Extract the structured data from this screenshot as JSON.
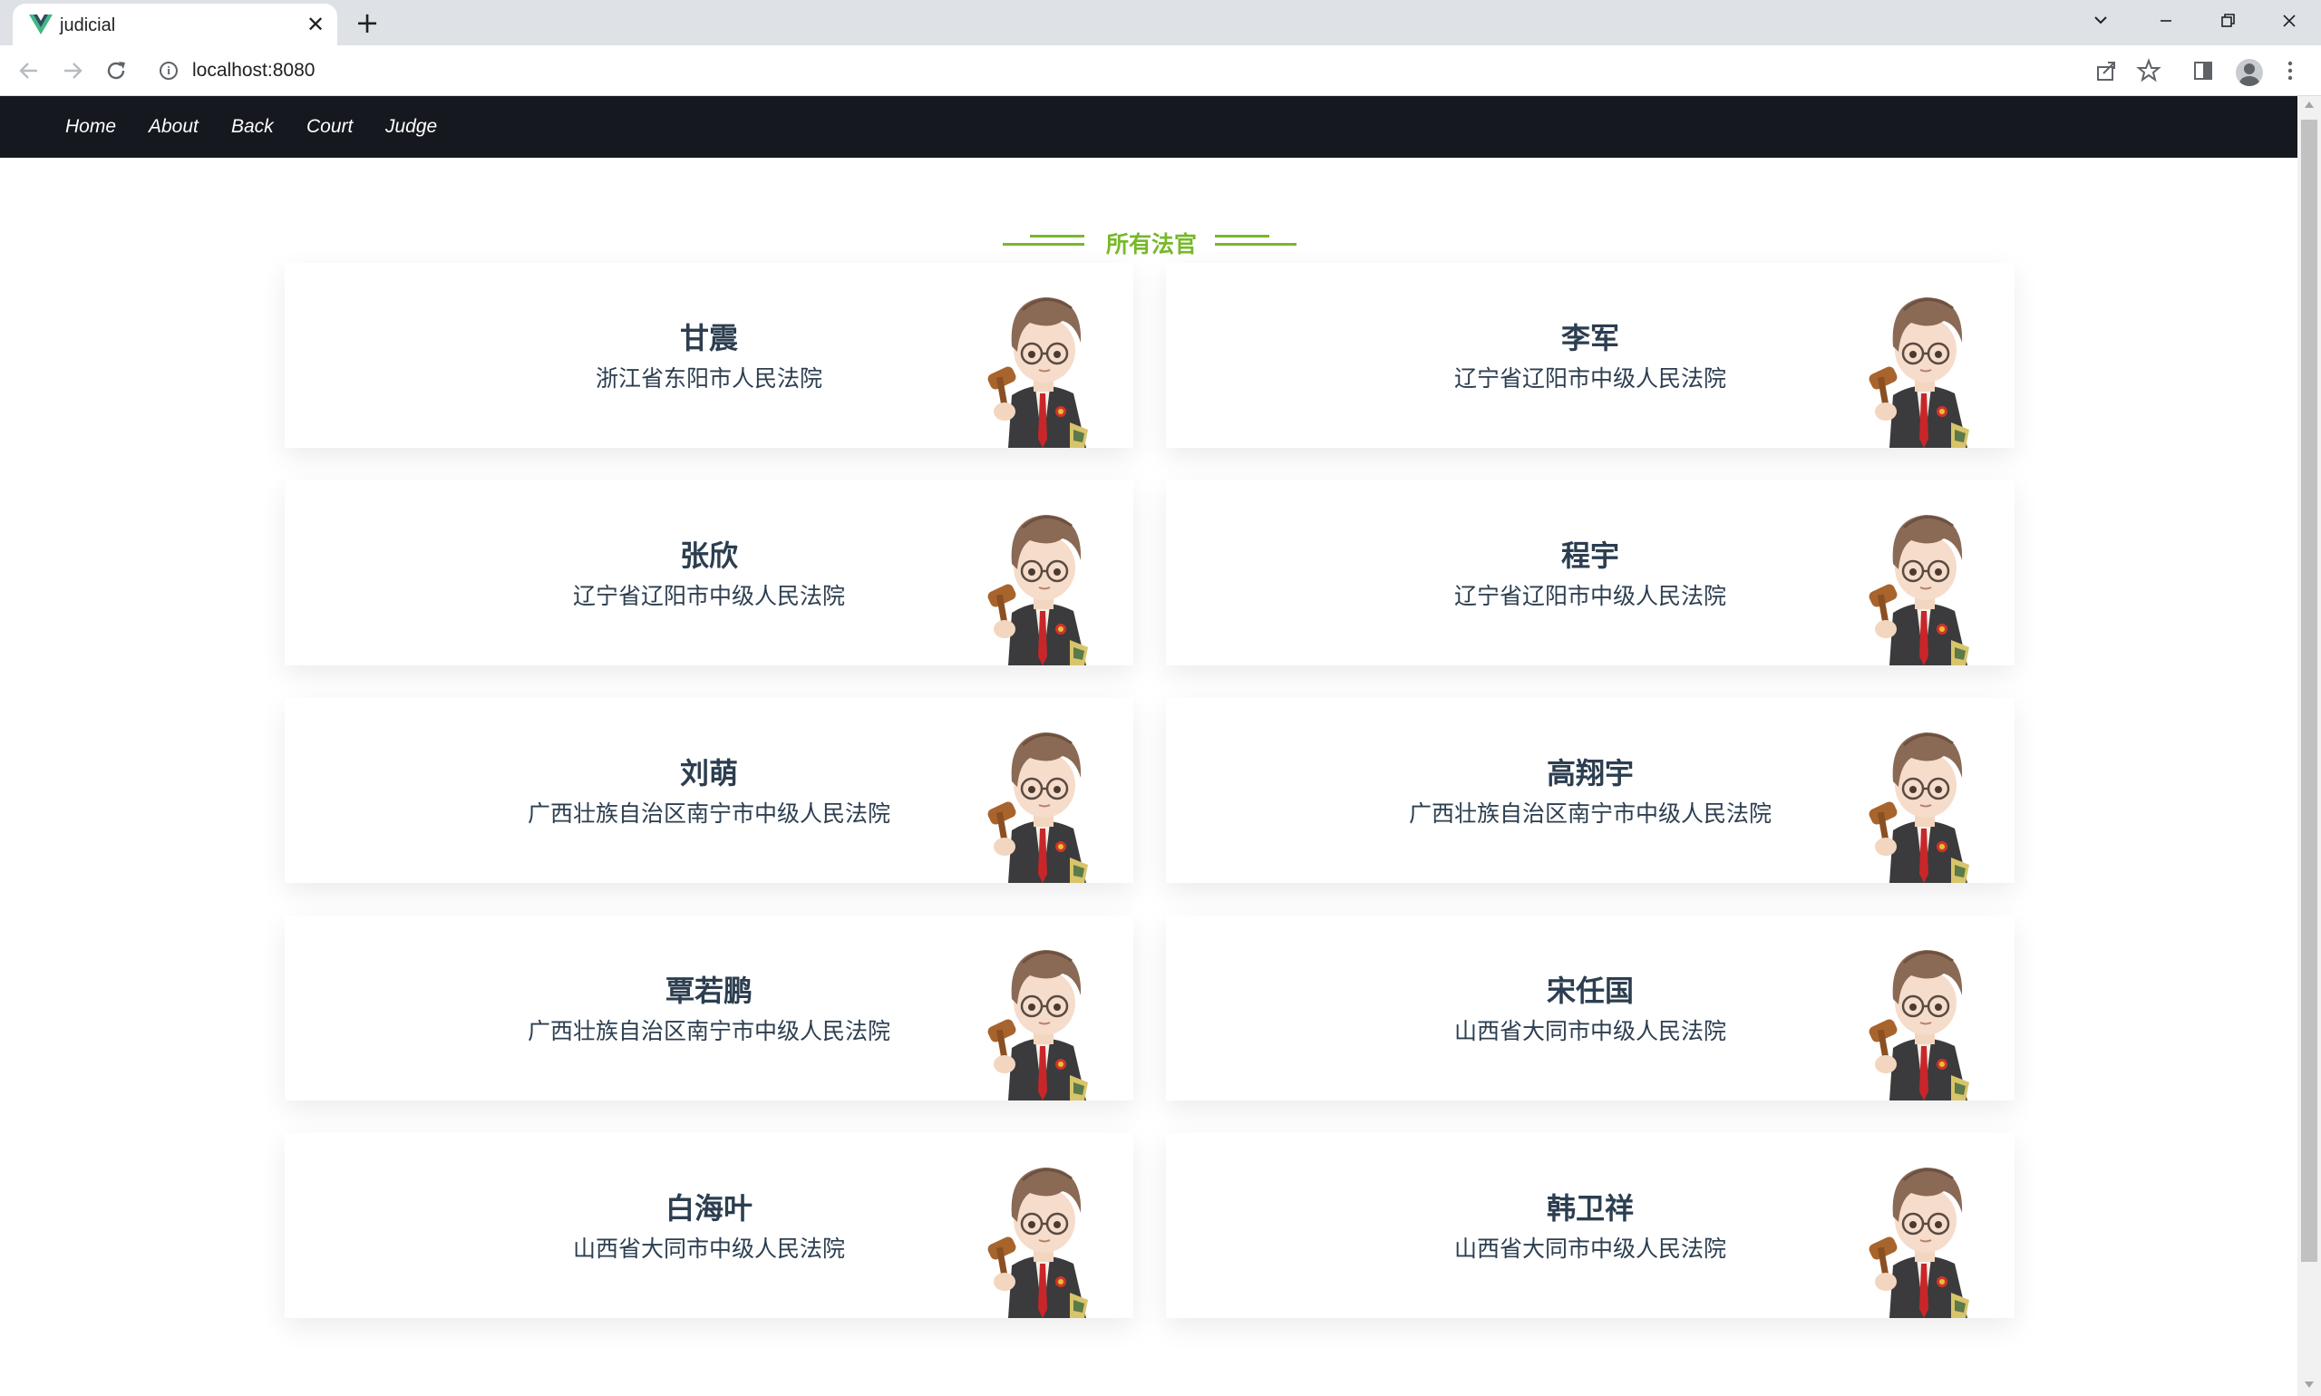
{
  "browser": {
    "tab_title": "judicial",
    "url": "localhost:8080",
    "new_tab_label": "+",
    "close_tab_label": "✕"
  },
  "nav": {
    "items": [
      {
        "label": "Home"
      },
      {
        "label": "About"
      },
      {
        "label": "Back"
      },
      {
        "label": "Court"
      },
      {
        "label": "Judge"
      }
    ]
  },
  "section": {
    "heading": "所有法官"
  },
  "judges": [
    {
      "name": "甘震",
      "court": "浙江省东阳市人民法院"
    },
    {
      "name": "李军",
      "court": "辽宁省辽阳市中级人民法院"
    },
    {
      "name": "张欣",
      "court": "辽宁省辽阳市中级人民法院"
    },
    {
      "name": "程宇",
      "court": "辽宁省辽阳市中级人民法院"
    },
    {
      "name": "刘萌",
      "court": "广西壮族自治区南宁市中级人民法院"
    },
    {
      "name": "高翔宇",
      "court": "广西壮族自治区南宁市中级人民法院"
    },
    {
      "name": "覃若鹏",
      "court": "广西壮族自治区南宁市中级人民法院"
    },
    {
      "name": "宋任国",
      "court": "山西省大同市中级人民法院"
    },
    {
      "name": "白海叶",
      "court": "山西省大同市中级人民法院"
    },
    {
      "name": "韩卫祥",
      "court": "山西省大同市中级人民法院"
    }
  ],
  "colors": {
    "nav_bg": "#161820",
    "accent_green": "#78b82a",
    "text_dark": "#2c3e50"
  },
  "icons": {
    "favicon": "vue-logo-icon",
    "back": "arrow-left-icon",
    "forward": "arrow-right-icon",
    "reload": "reload-icon",
    "site_info": "info-icon",
    "share": "share-icon",
    "bookmark": "star-icon",
    "side_panel": "side-panel-icon",
    "profile": "profile-icon",
    "menu": "kebab-menu-icon",
    "judge_avatar": "judge-cartoon-icon"
  }
}
